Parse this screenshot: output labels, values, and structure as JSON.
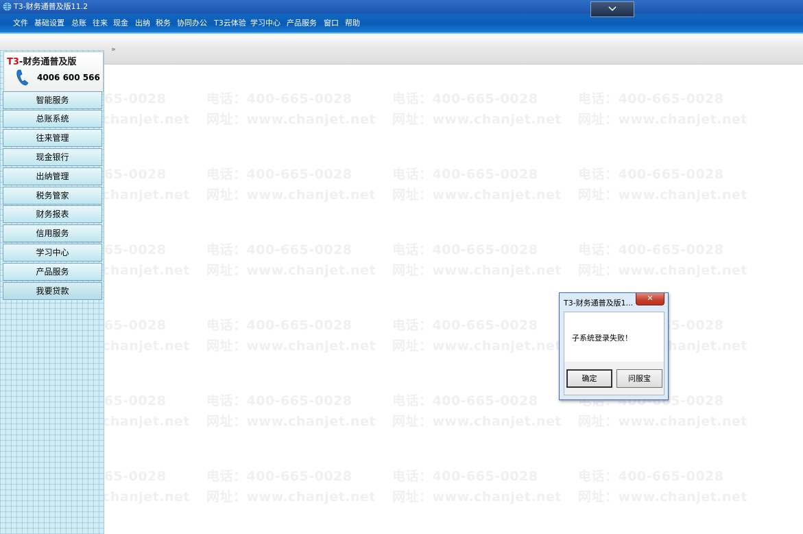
{
  "window": {
    "title": "T3-财务通普及版11.2",
    "icon": "app-globe-icon"
  },
  "menu": [
    "文件",
    "基础设置",
    "总账",
    "往来",
    "现金",
    "出纳",
    "税务",
    "协同办公",
    "T3云体验",
    "学习中心",
    "产品服务",
    "窗口",
    "帮助"
  ],
  "toolbar": {
    "expand_label": "»"
  },
  "brand": {
    "prefix": "T3",
    "name": "-财务通普及版",
    "phone": "4006 600 566"
  },
  "sidebar": {
    "items": [
      "智能服务",
      "总账系统",
      "往来管理",
      "现金银行",
      "出纳管理",
      "税务管家",
      "财务报表",
      "信用服务",
      "学习中心",
      "产品服务",
      "我要贷款"
    ]
  },
  "watermark": {
    "phone_line": "电话：400-665-0028",
    "site_line": "网址：www.chanjet.net"
  },
  "dialog": {
    "title": "T3-财务通普及版1...",
    "close_label": "✕",
    "message": "子系统登录失败！",
    "ok_label": "确定",
    "help_label": "问服宝"
  },
  "colors": {
    "menubar": "#0a5cb6",
    "sidebar": "#d4eef5",
    "brand_accent": "#d0101a",
    "close_button": "#c4402c"
  }
}
